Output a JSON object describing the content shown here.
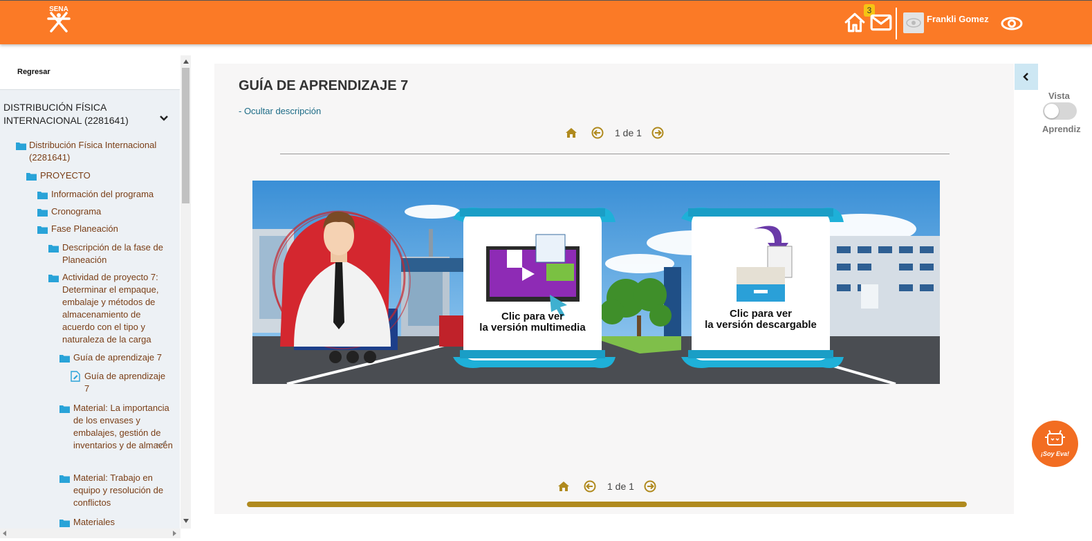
{
  "header": {
    "logo_text": "SENA",
    "notifications_count": "3",
    "user_name": "Frankli Gomez"
  },
  "sidebar": {
    "back_label": "Regresar",
    "course_title": "DISTRIBUCIÓN FÍSICA INTERNACIONAL (2281641)",
    "items": [
      {
        "label": "Distribución Física Internacional (2281641)"
      },
      {
        "label": "PROYECTO"
      },
      {
        "label": "Información del programa"
      },
      {
        "label": "Cronograma"
      },
      {
        "label": "Fase Planeación"
      },
      {
        "label": "Descripción de la fase de Planeación"
      },
      {
        "label": "Actividad de proyecto 7: Determinar el empaque, embalaje y métodos de almacenamiento de acuerdo con el tipo y naturaleza de la carga"
      },
      {
        "label": "Guía de aprendizaje 7"
      },
      {
        "label": "Guía de aprendizaje 7"
      },
      {
        "label": "Material: La importancia de los envases y embalajes, gestión de inventarios y de almacén"
      },
      {
        "label": "Material: Trabajo en equipo y resolución de conflictos"
      },
      {
        "label": "Materiales"
      }
    ]
  },
  "main": {
    "title": "GUÍA DE APRENDIZAJE 7",
    "toggle_description": "- Ocultar descripción",
    "pager_top": "1 de 1",
    "pager_bottom": "1 de 1",
    "progress": 1.0,
    "banner": {
      "left_button_line1": "Clic para ver",
      "left_button_line2": "la versión multimedia",
      "right_button_line1": "Clic para ver",
      "right_button_line2": "la versión descargable"
    }
  },
  "right_panel": {
    "vista_label": "Vista",
    "aprendiz_label": "Aprendiz",
    "eva_label": "¡Soy Eva!"
  },
  "colors": {
    "header": "#fb7a26",
    "accent_gold": "#b08a1e",
    "folder_blue": "#29a3d8",
    "link_teal": "#1c6b86"
  }
}
